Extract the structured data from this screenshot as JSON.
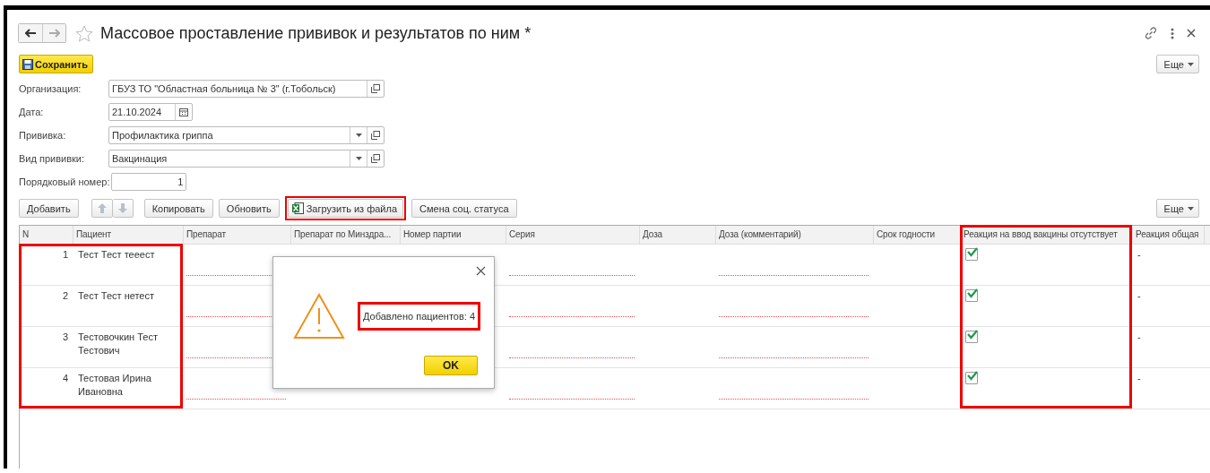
{
  "window": {
    "title": "Массовое проставление прививок и результатов по ним *",
    "favorite": false
  },
  "save_button": {
    "label": "Сохранить"
  },
  "more_button_top": {
    "label": "Еще"
  },
  "fields": [
    {
      "label": "Организация:",
      "kind": "open",
      "value": "ГБУЗ ТО \"Областная больница № 3\" (г.Тобольск)"
    },
    {
      "label": "Дата:",
      "kind": "date",
      "value": "21.10.2024"
    },
    {
      "label": "Прививка:",
      "kind": "select",
      "value": "Профилактика гриппа"
    },
    {
      "label": "Вид прививки:",
      "kind": "select",
      "value": "Вакцинация"
    },
    {
      "label": "Порядковый номер:",
      "kind": "number",
      "value": "1"
    }
  ],
  "toolbar": {
    "buttons": [
      {
        "label": "Добавить",
        "kind": "text",
        "highlighted": false
      },
      {
        "kind": "arrows",
        "disabled": true
      },
      {
        "label": "Копировать",
        "kind": "text",
        "highlighted": false
      },
      {
        "label": "Обновить",
        "kind": "text",
        "highlighted": false
      },
      {
        "label": "Загрузить из файла",
        "kind": "excel",
        "highlighted": true
      },
      {
        "label": "Смена соц. статуса",
        "kind": "text",
        "highlighted": false
      }
    ],
    "more_label": "Еще"
  },
  "table": {
    "columns": [
      {
        "title": "N",
        "highlighted": true,
        "header_highlighted": false,
        "required": false
      },
      {
        "title": "Пациент",
        "highlighted": true,
        "header_highlighted": false,
        "required": false
      },
      {
        "title": "Препарат",
        "highlighted": false,
        "header_highlighted": false,
        "required": true
      },
      {
        "title": "Препарат по Минздра...",
        "highlighted": false,
        "header_highlighted": false,
        "required": false
      },
      {
        "title": "Номер партии",
        "highlighted": false,
        "header_highlighted": false,
        "required": false
      },
      {
        "title": "Серия",
        "highlighted": false,
        "header_highlighted": false,
        "required": true
      },
      {
        "title": "Доза",
        "highlighted": false,
        "header_highlighted": false,
        "required": false
      },
      {
        "title": "Доза (комментарий)",
        "highlighted": false,
        "header_highlighted": false,
        "required": true
      },
      {
        "title": "Срок годности",
        "highlighted": false,
        "header_highlighted": false,
        "required": false
      },
      {
        "title": "Реакция на ввод вакцины отсутствует",
        "highlighted": true,
        "header_highlighted": true,
        "required": false
      },
      {
        "title": "Реакция общая",
        "highlighted": false,
        "header_highlighted": false,
        "required": false
      }
    ],
    "rows": [
      {
        "n": "1",
        "patient": "Тест Тест тееест",
        "reaction_absent": true,
        "general_reaction": "-"
      },
      {
        "n": "2",
        "patient": "Тест Тест нетест",
        "reaction_absent": true,
        "general_reaction": "-"
      },
      {
        "n": "3",
        "patient": "Тестовочкин Тест Тестович",
        "reaction_absent": true,
        "general_reaction": "-"
      },
      {
        "n": "4",
        "patient": "Тестовая Ирина Ивановна",
        "reaction_absent": true,
        "general_reaction": "-"
      }
    ]
  },
  "dialog": {
    "message": "Добавлено пациентов: 4",
    "message_highlighted": true,
    "ok_label": "OK"
  }
}
